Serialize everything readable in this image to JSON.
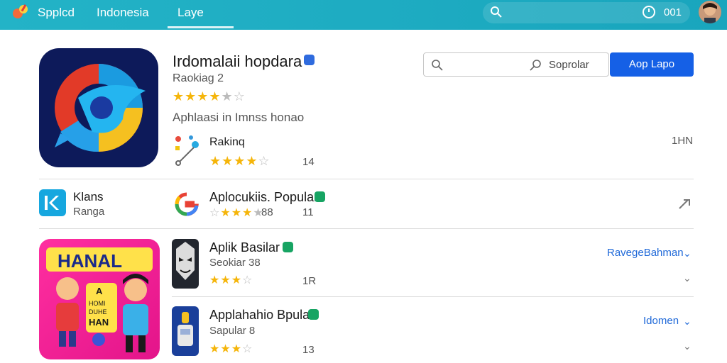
{
  "topbar": {
    "brand": "Spplcd",
    "nav": [
      "Indonesia",
      "Laye"
    ],
    "status_value": "001"
  },
  "hero": {
    "title": "Irdomalaii hopdara",
    "ranking": "Raokiag 2",
    "rating_stars": 4.5,
    "description": "Aphlaasi in Imnss honao",
    "meta_label": "Rakinq",
    "meta_rating_stars": 4,
    "meta_count": "14",
    "meta_right": "1HN"
  },
  "search": {
    "label": "Soprolar",
    "button": "Aop Lapo"
  },
  "category": {
    "title": "Klans",
    "subtitle": "Ranga"
  },
  "apps": [
    {
      "name": "Aplocukiis. Popular",
      "rating_stars": 3.5,
      "rating": "88",
      "count": "11",
      "right": ""
    },
    {
      "name": "Aplik Basilar",
      "sub": "Seokiar 38",
      "rating_stars": 3,
      "count": "1R",
      "right": "RavegeBahman"
    },
    {
      "name": "Applahahio Bpular",
      "sub": "Sapular 8",
      "rating_stars": 3.5,
      "count": "13",
      "right": "Idomen"
    }
  ],
  "promo": {
    "text1": "HANAL",
    "text2": "A",
    "text3": "HOMI",
    "text4": "DUHE",
    "text5": "HAN"
  },
  "colors": {
    "topbar": "#1fa9c1",
    "accent": "#1560e6",
    "star": "#f5b50a",
    "badge_green": "#17a463",
    "badge_blue": "#2f6bde"
  }
}
